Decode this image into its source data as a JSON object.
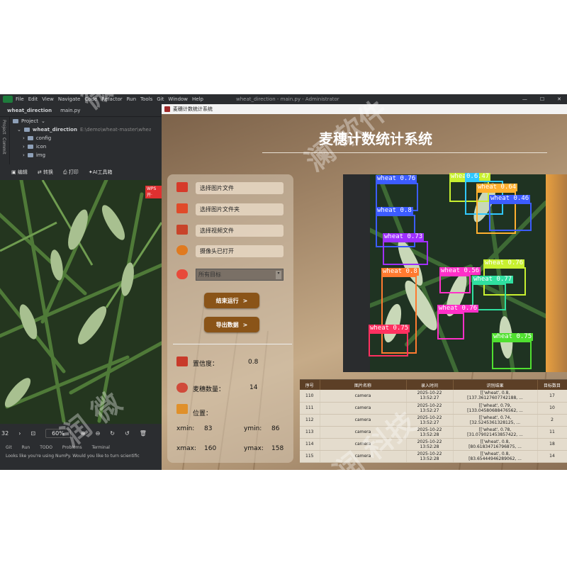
{
  "ide": {
    "menu": [
      "File",
      "Edit",
      "View",
      "Navigate",
      "Code",
      "Refactor",
      "Run",
      "Tools",
      "Git",
      "Window",
      "Help"
    ],
    "window_title": "wheat_direction - main.py - Administrator",
    "project_name": "wheat_direction",
    "open_file": "main.py",
    "side_tabs": [
      "Project",
      "Commit"
    ],
    "tree_header": "Project",
    "tree_root": "wheat_direction",
    "tree_root_path": "E:\\demo\\wheat-master\\wheat-master",
    "tree_items": [
      "config",
      "icon",
      "img"
    ],
    "status_tabs": [
      "Git",
      "Run",
      "TODO",
      "Problems",
      "Terminal"
    ],
    "status_message": "Looks like you're using NumPy. Would you like to turn scientific"
  },
  "viewer": {
    "tools": [
      "编辑",
      "转换",
      "打印",
      "AI工具箱"
    ],
    "badge": "WPS开·",
    "page_left": "32",
    "zoom": "60%"
  },
  "app": {
    "window_title": "麦穗计数统计系统",
    "title": "麦穗计数统计系统",
    "options": [
      "选择图片文件",
      "选择图片文件夹",
      "选择视频文件",
      "摄像头已打开"
    ],
    "target_select": "所有目标",
    "btn_stop": "结束运行",
    "btn_export": "导出数据",
    "chevron": ">",
    "confidence_label": "置信度：",
    "confidence_value": "0.8",
    "count_label": "麦穗数量：",
    "count_value": "14",
    "position_label": "位置：",
    "xmin_label": "xmin:",
    "xmin_value": "83",
    "ymin_label": "ymin:",
    "ymin_value": "86",
    "xmax_label": "xmax:",
    "xmax_value": "160",
    "ymax_label": "ymax:",
    "ymax_value": "158",
    "colors": {
      "accent_button": "#8a5418",
      "table_header": "#5c3f26"
    }
  },
  "detections": [
    {
      "label": "wheat 0.76",
      "color": "#3c5cff"
    },
    {
      "label": "wheat 0.47",
      "color": "#c8f030"
    },
    {
      "label": "0.6",
      "color": "#30c8ff"
    },
    {
      "label": "wheat 0.64",
      "color": "#ffb030"
    },
    {
      "label": "wheat 0.46",
      "color": "#3c5cff"
    },
    {
      "label": "wheat 0.8",
      "color": "#3c5cff"
    },
    {
      "label": "wheat 0.73",
      "color": "#a030ff"
    },
    {
      "label": "wheat 0.8",
      "color": "#ff7a30"
    },
    {
      "label": "wheat 0.56",
      "color": "#ff30c8"
    },
    {
      "label": "wheat 0.76",
      "color": "#c8f030"
    },
    {
      "label": "wheat 0.77",
      "color": "#30e0a0"
    },
    {
      "label": "wheat 0.76",
      "color": "#ff30c8"
    },
    {
      "label": "wheat 0.75",
      "color": "#ff3060"
    },
    {
      "label": "wheat 0.75",
      "color": "#50e030"
    }
  ],
  "table": {
    "headers": [
      "序号",
      "图片名称",
      "录入时间",
      "识别结果",
      "目标数目"
    ],
    "rows": [
      [
        "110",
        "camera",
        "2025-10-22",
        "13:52:27",
        "[['wheat', 0.8,",
        "[137.36127607742188, ...",
        "17"
      ],
      [
        "111",
        "camera",
        "2025-10-22",
        "13:52:27",
        "[['wheat', 0.79,",
        "[133.04580688476562, ...",
        "10"
      ],
      [
        "112",
        "camera",
        "2025-10-22",
        "13:52:27",
        "[['wheat', 0.74,",
        "[32.5245361328125, ...",
        "2"
      ],
      [
        "113",
        "camera",
        "2025-10-22",
        "13:52:28",
        "[['wheat', 0.78,",
        "[31.079021453857422, ...",
        "11"
      ],
      [
        "114",
        "camera",
        "2025-10-22",
        "13:52:28",
        "[['wheat', 0.8,",
        "[80.61834716796875, ...",
        "18"
      ],
      [
        "115",
        "camera",
        "2025-10-22",
        "13:52:28",
        "[['wheat', 0.8,",
        "[83.65444946289062, ...",
        "14"
      ]
    ]
  }
}
